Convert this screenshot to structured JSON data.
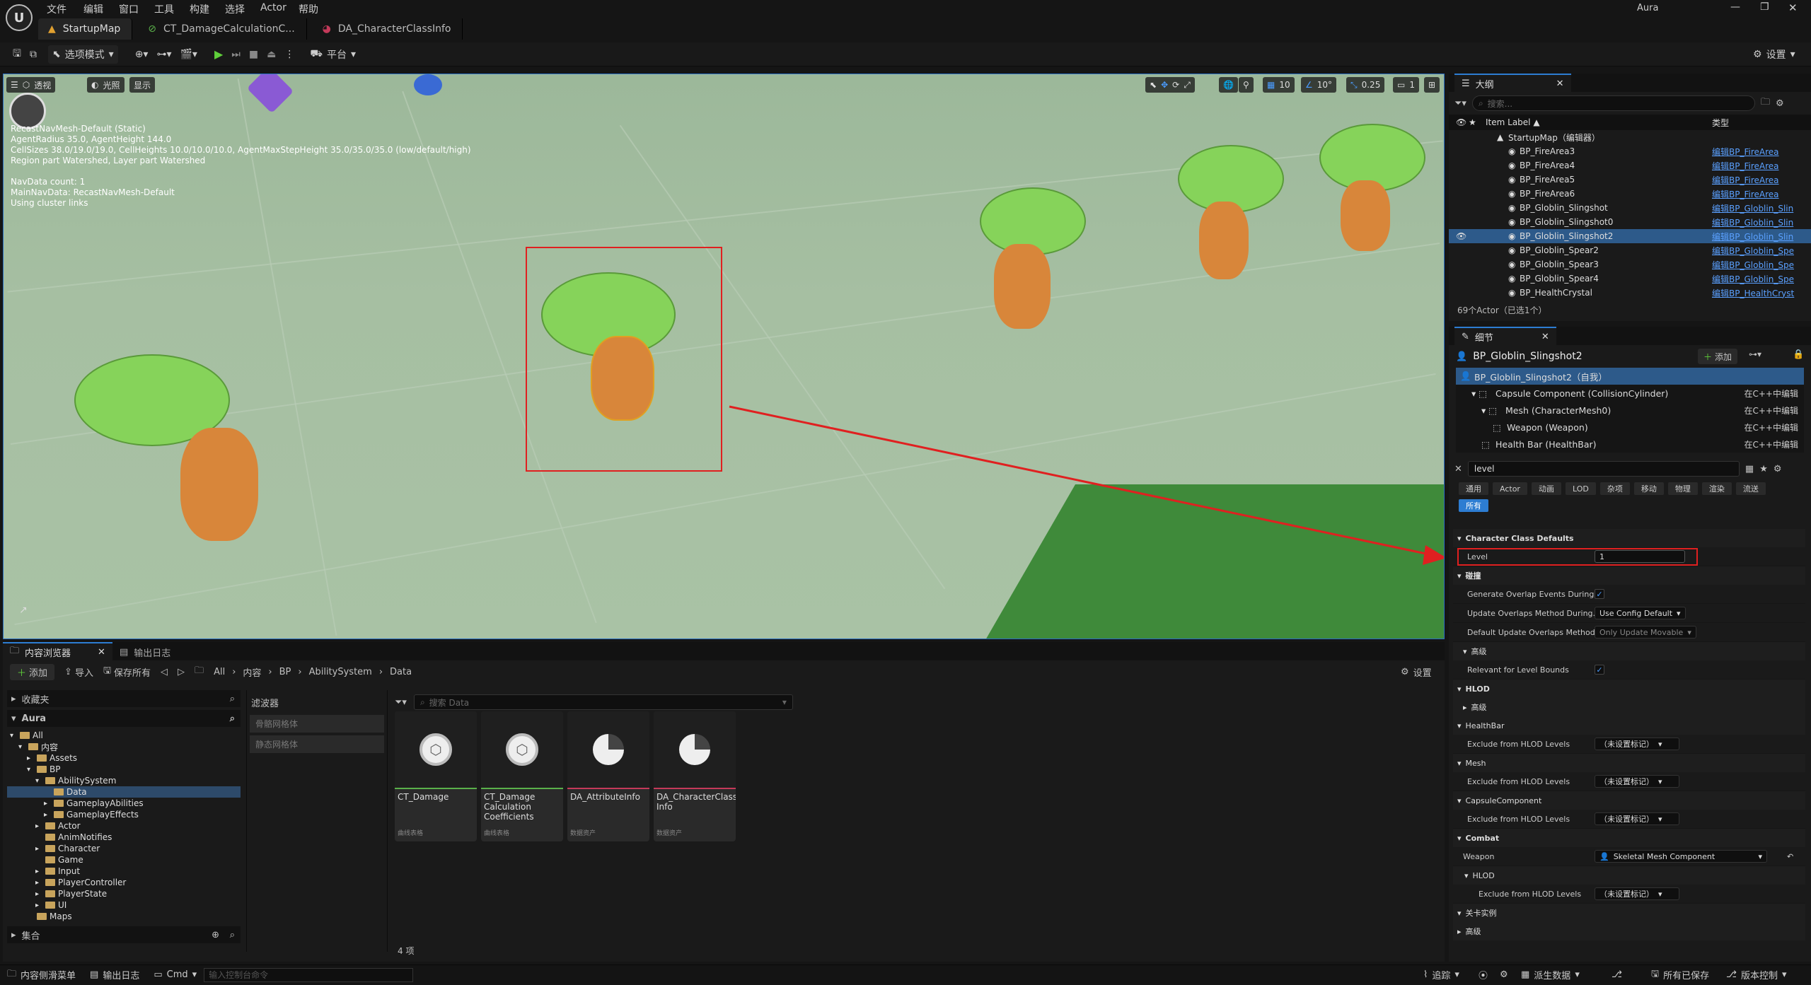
{
  "app": {
    "logo": "U",
    "menu": [
      "文件",
      "编辑",
      "窗口",
      "工具",
      "构建",
      "选择",
      "Actor",
      "帮助"
    ],
    "user": "Aura",
    "tabs": [
      {
        "label": "StartupMap",
        "icon": "level-icon"
      },
      {
        "label": "CT_DamageCalculationC...",
        "icon": "curve-table-icon"
      },
      {
        "label": "DA_CharacterClassInfo",
        "icon": "data-asset-icon"
      }
    ]
  },
  "toolbar": {
    "mode_label": "选项模式",
    "platform_label": "平台",
    "settings_label": "设置"
  },
  "viewport": {
    "perspective_label": "透视",
    "lit_label": "光照",
    "show_label": "显示",
    "grid_snap": "10",
    "rot_snap": "10°",
    "scale_snap": "0.25",
    "camera_speed": "1",
    "screen_pct": "1",
    "nav_info": "RecastNavMesh-Default (Static)\nAgentRadius 35.0, AgentHeight 144.0\nCellSizes 38.0/19.0/19.0, CellHeights 10.0/10.0/10.0, AgentMaxStepHeight 35.0/35.0/35.0 (low/default/high)\nRegion part Watershed, Layer part Watershed\n\nNavData count: 1\nMainNavData: RecastNavMesh-Default\nUsing cluster links"
  },
  "outliner": {
    "title": "大纲",
    "search_placeholder": "搜索...",
    "col_label": "Item Label ▲",
    "col_type": "类型",
    "root": "StartupMap（编辑器）",
    "rows": [
      {
        "name": "BP_FireArea3",
        "type": "编辑BP_FireArea"
      },
      {
        "name": "BP_FireArea4",
        "type": "编辑BP_FireArea"
      },
      {
        "name": "BP_FireArea5",
        "type": "编辑BP_FireArea"
      },
      {
        "name": "BP_FireArea6",
        "type": "编辑BP_FireArea"
      },
      {
        "name": "BP_Globlin_Slingshot",
        "type": "编辑BP_Globlin_Slin"
      },
      {
        "name": "BP_Globlin_Slingshot0",
        "type": "编辑BP_Globlin_Slin"
      },
      {
        "name": "BP_Globlin_Slingshot2",
        "type": "编辑BP_Globlin_Slin"
      },
      {
        "name": "BP_Globlin_Spear2",
        "type": "编辑BP_Globlin_Spe"
      },
      {
        "name": "BP_Globlin_Spear3",
        "type": "编辑BP_Globlin_Spe"
      },
      {
        "name": "BP_Globlin_Spear4",
        "type": "编辑BP_Globlin_Spe"
      },
      {
        "name": "BP_HealthCrystal",
        "type": "编辑BP_HealthCryst"
      }
    ],
    "footer": "69个Actor（已选1个）"
  },
  "details": {
    "title": "细节",
    "actor_name": "BP_Globlin_Slingshot2",
    "add_label": "添加",
    "components": [
      {
        "name": "BP_Globlin_Slingshot2（自我）",
        "edit": ""
      },
      {
        "name": "Capsule Component (CollisionCylinder)",
        "edit": "在C++中编辑"
      },
      {
        "name": "Mesh (CharacterMesh0)",
        "edit": "在C++中编辑"
      },
      {
        "name": "Weapon (Weapon)",
        "edit": "在C++中编辑"
      },
      {
        "name": "Health Bar (HealthBar)",
        "edit": "在C++中编辑"
      }
    ],
    "search_value": "level",
    "filters": [
      "通用",
      "Actor",
      "动画",
      "LOD",
      "杂项",
      "移动",
      "物理",
      "渲染",
      "流送",
      "所有"
    ],
    "sections": {
      "char_class": "Character Class Defaults",
      "level_label": "Level",
      "level_value": "1",
      "collision": "碰撞",
      "gen_overlap": "Generate Overlap Events During...",
      "update_overlap": "Update Overlaps Method During...",
      "update_overlap_val": "Use Config Default",
      "default_overlap": "Default Update Overlaps Method...",
      "default_overlap_val": "Only Update Movable",
      "advanced": "高级",
      "relevant_bounds": "Relevant for Level Bounds",
      "hlod": "HLOD",
      "healthbar": "HealthBar",
      "exclude_hlod": "Exclude from HLOD Levels",
      "unset_tag": "（未设置标记）",
      "mesh": "Mesh",
      "capsule": "CapsuleComponent",
      "combat": "Combat",
      "weapon": "Weapon",
      "weapon_val": "Skeletal Mesh Component",
      "level_instance": "关卡实例"
    }
  },
  "content_browser": {
    "tab": "内容浏览器",
    "log_tab": "输出日志",
    "add": "添加",
    "import": "导入",
    "save_all": "保存所有",
    "breadcrumb": [
      "All",
      "内容",
      "BP",
      "AbilitySystem",
      "Data"
    ],
    "settings": "设置",
    "favorites": "收藏夹",
    "project": "Aura",
    "filters_title": "滤波器",
    "filter_items": [
      "骨骼网格体",
      "静态网格体"
    ],
    "search_placeholder": "搜索 Data",
    "tree": [
      {
        "label": "All",
        "depth": 0
      },
      {
        "label": "内容",
        "depth": 1
      },
      {
        "label": "Assets",
        "depth": 2
      },
      {
        "label": "BP",
        "depth": 2
      },
      {
        "label": "AbilitySystem",
        "depth": 3
      },
      {
        "label": "Data",
        "depth": 4
      },
      {
        "label": "GameplayAbilities",
        "depth": 4
      },
      {
        "label": "GameplayEffects",
        "depth": 4
      },
      {
        "label": "Actor",
        "depth": 3
      },
      {
        "label": "AnimNotifies",
        "depth": 3
      },
      {
        "label": "Character",
        "depth": 3
      },
      {
        "label": "Game",
        "depth": 3
      },
      {
        "label": "Input",
        "depth": 3
      },
      {
        "label": "PlayerController",
        "depth": 3
      },
      {
        "label": "PlayerState",
        "depth": 3
      },
      {
        "label": "UI",
        "depth": 3
      },
      {
        "label": "Maps",
        "depth": 2
      }
    ],
    "collections": "集合",
    "assets": [
      {
        "name": "CT_Damage",
        "type": "曲线表格",
        "color": "#5ab04a"
      },
      {
        "name": "CT_Damage Calculation Coefficients",
        "type": "曲线表格",
        "color": "#5ab04a"
      },
      {
        "name": "DA_AttributeInfo",
        "type": "数据资产",
        "color": "#c43a5a"
      },
      {
        "name": "DA_CharacterClass Info",
        "type": "数据资产",
        "color": "#c43a5a"
      }
    ],
    "count": "4 项"
  },
  "statusbar": {
    "drawer": "内容侧滑菜单",
    "log": "输出日志",
    "cmd": "Cmd",
    "console_placeholder": "输入控制台命令",
    "trace": "追踪",
    "derived": "派生数据",
    "saved": "所有已保存",
    "vcs": "版本控制"
  },
  "colors": {
    "accent": "#2d7dd2",
    "highlight_box": "#e02020"
  }
}
